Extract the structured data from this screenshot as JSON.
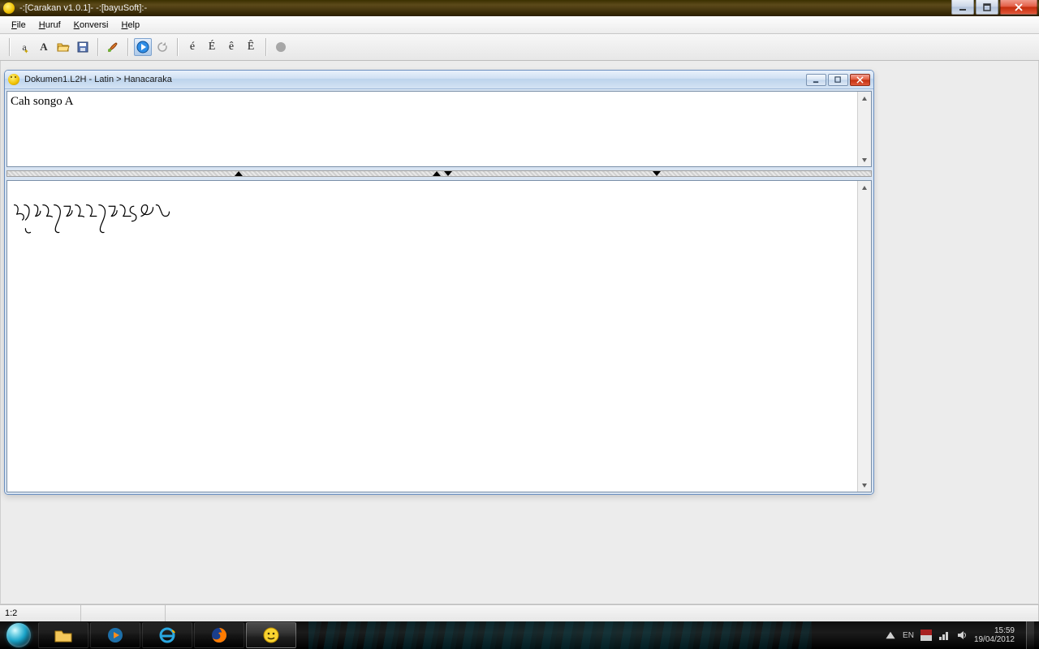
{
  "app": {
    "title": "-:[Carakan v1.0.1]- -:[bayuSoft]:-"
  },
  "menu": {
    "file": "File",
    "huruf": "Huruf",
    "konversi": "Konversi",
    "help": "Help"
  },
  "toolbar": {
    "e1": "é",
    "e2": "É",
    "e3": "ê",
    "e4": "Ê"
  },
  "doc": {
    "title": "Dokumen1.L2H - Latin > Hanacaraka",
    "input_text": "Cah songo A",
    "output_text": "ꦕꦃ​ꦱꦺꦴꦔꦺꦴ​ꦄ"
  },
  "status": {
    "col_row": "1:2"
  },
  "taskbar": {
    "lang": "EN",
    "time": "15:59",
    "date": "19/04/2012"
  }
}
